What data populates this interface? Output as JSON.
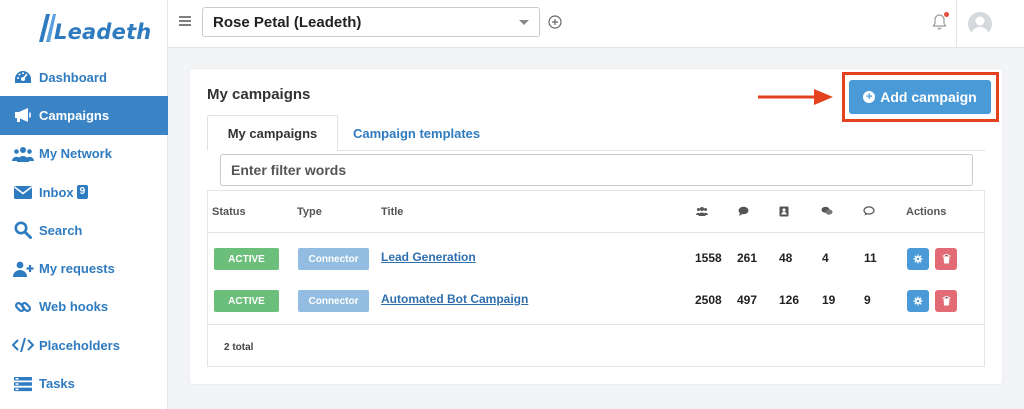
{
  "brand": {
    "logo_text": "Leadeth"
  },
  "sidebar": {
    "items": [
      {
        "label": "Dashboard",
        "icon": "tachometer-icon"
      },
      {
        "label": "Campaigns",
        "icon": "megaphone-icon",
        "active": true
      },
      {
        "label": "My Network",
        "icon": "users-icon"
      },
      {
        "label": "Inbox",
        "icon": "envelope-icon",
        "badge": "9"
      },
      {
        "label": "Search",
        "icon": "search-icon"
      },
      {
        "label": "My requests",
        "icon": "user-plus-icon"
      },
      {
        "label": "Web hooks",
        "icon": "link-icon"
      },
      {
        "label": "Placeholders",
        "icon": "code-icon"
      },
      {
        "label": "Tasks",
        "icon": "tasks-icon"
      }
    ]
  },
  "header": {
    "account": "Rose Petal (Leadeth)"
  },
  "main": {
    "title": "My campaigns",
    "add_button": "Add campaign",
    "tabs": [
      {
        "label": "My campaigns",
        "active": true
      },
      {
        "label": "Campaign templates",
        "active": false
      }
    ],
    "filter_placeholder": "Enter filter words",
    "table": {
      "headers": {
        "status": "Status",
        "type": "Type",
        "title": "Title",
        "actions": "Actions"
      },
      "stat_icons": [
        "users-icon",
        "comment-icon",
        "address-book-icon",
        "comments-icon",
        "comment-dots-icon"
      ],
      "rows": [
        {
          "status": "ACTIVE",
          "type": "Connector",
          "title": "Lead Generation",
          "stats": [
            "1558",
            "261",
            "48",
            "4",
            "11"
          ]
        },
        {
          "status": "ACTIVE",
          "type": "Connector",
          "title": "Automated Bot Campaign",
          "stats": [
            "2508",
            "497",
            "126",
            "19",
            "9"
          ]
        }
      ],
      "footer": "2 total"
    }
  },
  "colors": {
    "accent": "#3a84c5",
    "active_green": "#6cbf7b",
    "connector_blue": "#93bde0",
    "delete_red": "#e36b75",
    "highlight_red": "#e4411f"
  }
}
